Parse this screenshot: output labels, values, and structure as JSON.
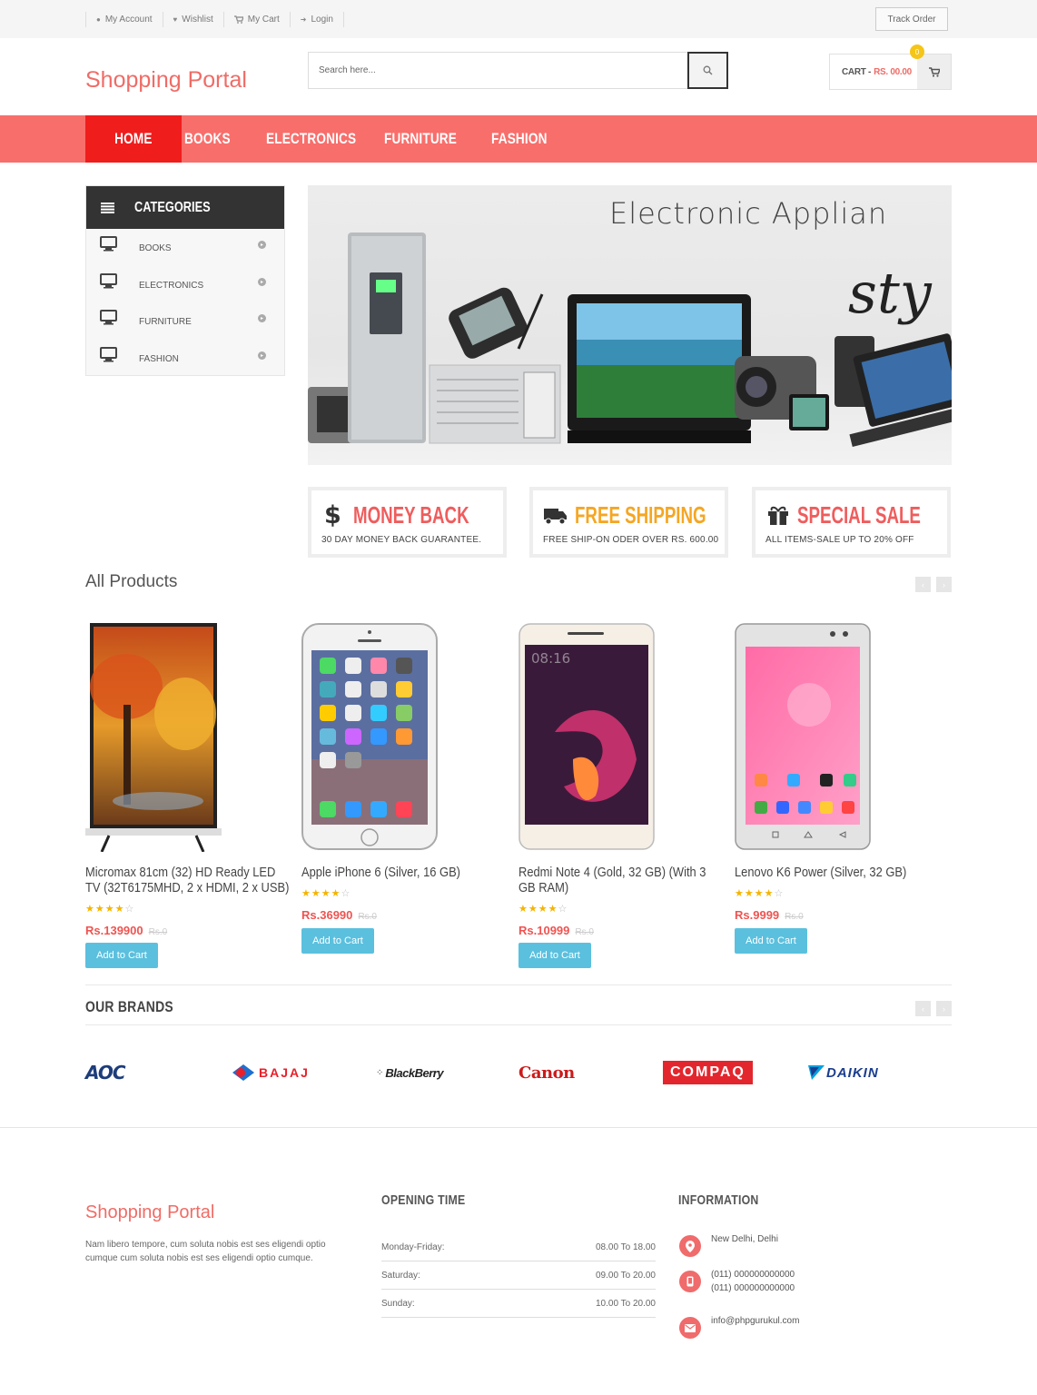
{
  "topbar": {
    "links": [
      {
        "label": "My Account",
        "icon": "user-icon"
      },
      {
        "label": "Wishlist",
        "icon": "heart-icon"
      },
      {
        "label": "My Cart",
        "icon": "cart-icon"
      },
      {
        "label": "Login",
        "icon": "sign-in-icon"
      }
    ],
    "track_order": "Track Order"
  },
  "header": {
    "logo": "Shopping Portal",
    "search_placeholder": "Search here...",
    "cart_label": "CART -",
    "cart_amount": "RS. 00.00",
    "cart_count": "0"
  },
  "nav": {
    "items": [
      "HOME",
      "BOOKS",
      "ELECTRONICS",
      "FURNITURE",
      "FASHION"
    ],
    "active": "HOME"
  },
  "categories": {
    "title": "CATEGORIES",
    "items": [
      "BOOKS",
      "ELECTRONICS",
      "FURNITURE",
      "FASHION"
    ]
  },
  "banner": {
    "title": "Electronic Applian",
    "script_word": "sty"
  },
  "features": [
    {
      "title": "MONEY BACK",
      "subtitle": "30 DAY MONEY BACK GUARANTEE.",
      "icon": "dollar-icon",
      "color": "#ef5d5d"
    },
    {
      "title": "FREE SHIPPING",
      "subtitle": "FREE SHIP-ON ODER OVER RS. 600.00",
      "icon": "truck-icon",
      "color": "#f5a623"
    },
    {
      "title": "SPECIAL SALE",
      "subtitle": "ALL ITEMS-SALE UP TO 20% OFF",
      "icon": "gift-icon",
      "color": "#ef5d5d"
    }
  ],
  "products_section": {
    "title": "All Products",
    "products": [
      {
        "title": "Micromax 81cm (32) HD Ready LED TV (32T6175MHD, 2 x HDMI, 2 x USB)",
        "rating": 4,
        "max_rating": 5,
        "price": "Rs.139900",
        "old_price": "Rs.0",
        "button": "Add to Cart"
      },
      {
        "title": "Apple iPhone 6 (Silver, 16 GB)",
        "rating": 4,
        "max_rating": 5,
        "price": "Rs.36990",
        "old_price": "Rs.0",
        "button": "Add to Cart"
      },
      {
        "title": "Redmi Note 4 (Gold, 32 GB) (With 3 GB RAM)",
        "rating": 4,
        "max_rating": 5,
        "price": "Rs.10999",
        "old_price": "Rs.0",
        "button": "Add to Cart"
      },
      {
        "title": "Lenovo K6 Power (Silver, 32 GB)",
        "rating": 4,
        "max_rating": 5,
        "price": "Rs.9999",
        "old_price": "Rs.0",
        "button": "Add to Cart"
      }
    ]
  },
  "brands": {
    "title": "OUR BRANDS",
    "items": [
      "AOC",
      "BAJAJ",
      "BlackBerry",
      "Canon",
      "COMPAQ",
      "DAIKIN"
    ]
  },
  "footer": {
    "logo": "Shopping Portal",
    "description": "Nam libero tempore, cum soluta nobis est ses eligendi optio cumque cum soluta nobis est ses eligendi optio cumque.",
    "opening_title": "OPENING TIME",
    "hours": [
      {
        "day": "Monday-Friday:",
        "time": "08.00 To 18.00"
      },
      {
        "day": "Saturday:",
        "time": "09.00 To 20.00"
      },
      {
        "day": "Sunday:",
        "time": "10.00 To 20.00"
      }
    ],
    "info_title": "INFORMATION",
    "address": "New Delhi, Delhi",
    "phone1": "(011) 000000000000",
    "phone2": "(011) 000000000000",
    "email": "info@phpgurukul.com"
  },
  "colors": {
    "brand": "#ef6c66",
    "nav": "#f86e6b",
    "nav_active": "#f01d1d",
    "button": "#5bc0de",
    "star": "#f5b301"
  }
}
